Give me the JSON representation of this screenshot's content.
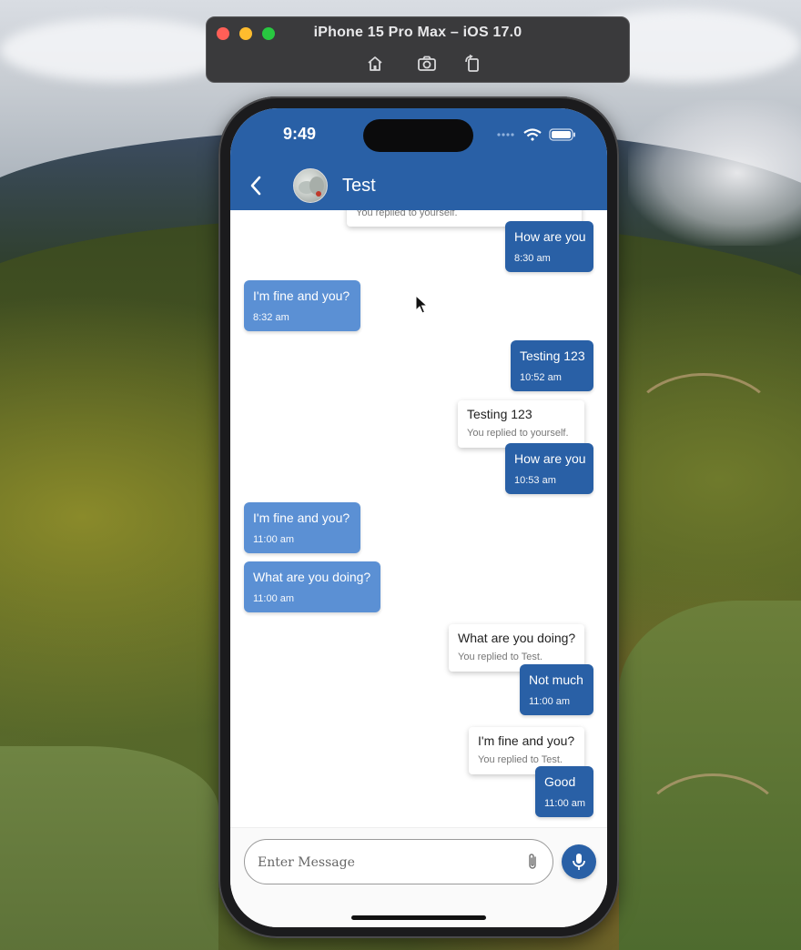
{
  "simulator": {
    "title": "iPhone 15 Pro Max – iOS 17.0",
    "tools": [
      "home-icon",
      "screenshot-icon",
      "rotate-icon"
    ]
  },
  "status_bar": {
    "time": "9:49"
  },
  "header": {
    "contact_name": "Test",
    "color": "#2960a6"
  },
  "messages": [
    {
      "type": "reply-preview",
      "text": "",
      "sub": "You replied to yourself."
    },
    {
      "type": "sent",
      "text": "How are you",
      "time": "8:30 am"
    },
    {
      "type": "received",
      "text": "I'm fine and you?",
      "time": "8:32 am"
    },
    {
      "type": "sent",
      "text": "Testing 123",
      "time": "10:52 am"
    },
    {
      "type": "reply-preview",
      "text": "Testing 123",
      "sub": "You replied to yourself."
    },
    {
      "type": "sent",
      "text": "How are you",
      "time": "10:53 am"
    },
    {
      "type": "received",
      "text": "I'm fine and you?",
      "time": "11:00 am"
    },
    {
      "type": "received",
      "text": "What are you doing?",
      "time": "11:00 am"
    },
    {
      "type": "reply-preview",
      "text": "What are you doing?",
      "sub": "You replied to Test."
    },
    {
      "type": "sent",
      "text": "Not much",
      "time": "11:00 am"
    },
    {
      "type": "reply-preview",
      "text": "I'm fine and you?",
      "sub": "You replied to Test."
    },
    {
      "type": "sent",
      "text": "Good",
      "time": "11:00 am"
    }
  ],
  "composer": {
    "placeholder": "Enter Message",
    "value": ""
  },
  "colors": {
    "sent_bubble": "#2960a6",
    "received_bubble": "#5b90d4"
  }
}
